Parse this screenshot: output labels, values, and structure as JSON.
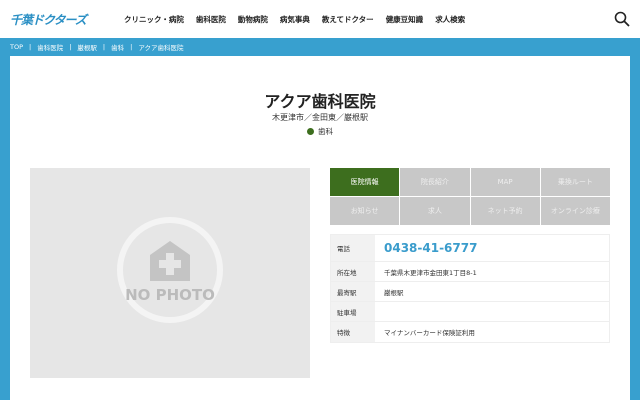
{
  "header": {
    "logo": "千葉ドクターズ",
    "nav": [
      "クリニック・病院",
      "歯科医院",
      "動物病院",
      "病気事典",
      "教えてドクター",
      "健康豆知識",
      "求人検索"
    ]
  },
  "breadcrumb": [
    "TOP",
    "歯科医院",
    "巌根駅",
    "歯科",
    "アクア歯科医院"
  ],
  "clinic": {
    "name": "アクア歯科医院",
    "location": "木更津市／金田東／巌根駅",
    "category": "歯科",
    "photo_placeholder": "NO PHOTO"
  },
  "tabs": [
    "医院情報",
    "院長紹介",
    "MAP",
    "乗換ルート",
    "お知らせ",
    "求人",
    "ネット予約",
    "オンライン診療"
  ],
  "info": [
    {
      "label": "電話",
      "value": "0438-41-6777"
    },
    {
      "label": "所在地",
      "value": "千葉県木更津市金田東1丁目8-1"
    },
    {
      "label": "最寄駅",
      "value": "巌根駅"
    },
    {
      "label": "駐車場",
      "value": ""
    },
    {
      "label": "特徴",
      "value": "マイナンバーカード保険証利用"
    }
  ]
}
